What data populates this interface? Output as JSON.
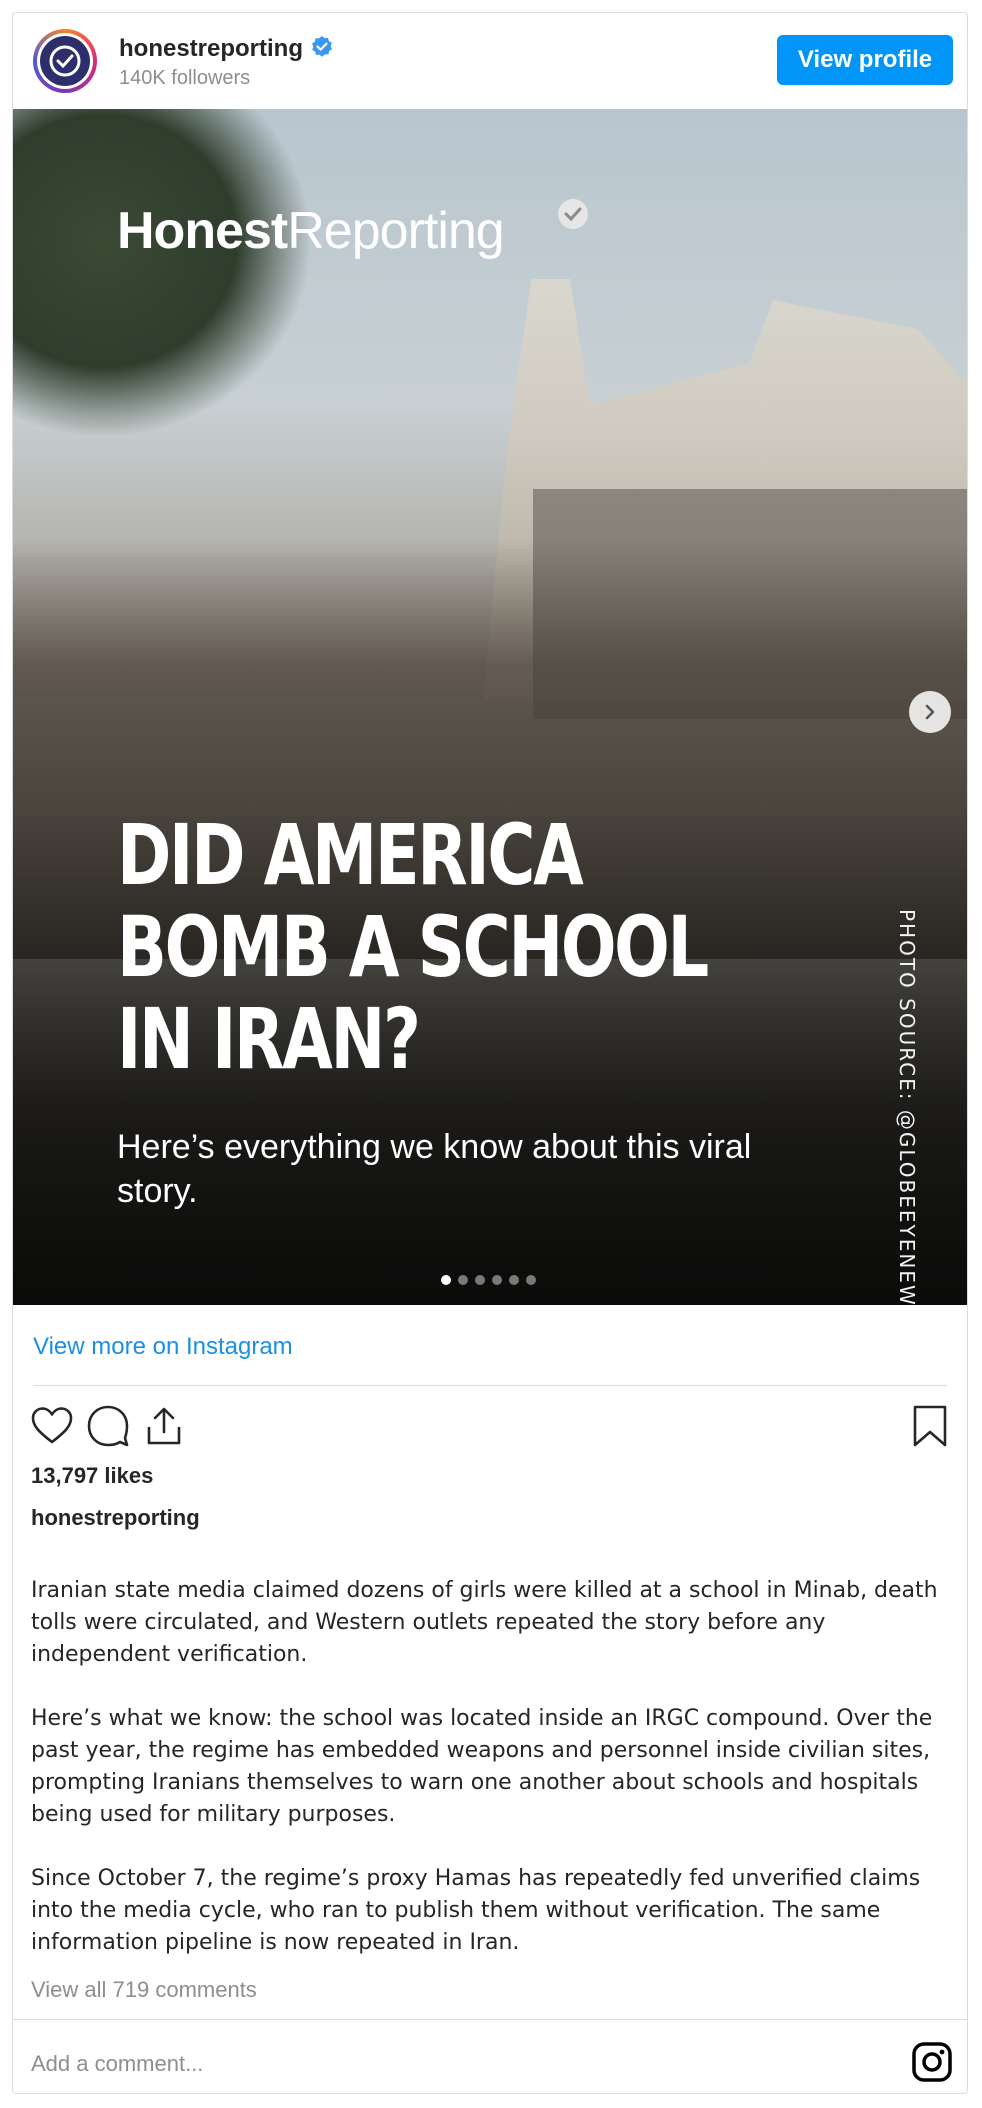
{
  "header": {
    "username": "honestreporting",
    "followers": "140K followers",
    "view_profile_label": "View profile"
  },
  "media": {
    "brand_bold": "Honest",
    "brand_light": "Reporting",
    "headline": "DID AMERICA\nBOMB A SCHOOL\nIN IRAN?",
    "subhead": "Here’s everything we know about this viral story.",
    "photo_source": "PHOTO SOURCE: @GLOBEEYENEWS/X",
    "slide_count": 6,
    "active_slide": 1
  },
  "view_more_label": "View more on Instagram",
  "likes": "13,797 likes",
  "caption": {
    "username": "honestreporting",
    "paragraphs": [
      "Iranian state media claimed dozens of girls were killed at a school in Minab, death tolls were circulated, and Western outlets repeated the story before any independent verification.",
      "Here’s what we know: the school was located inside an IRGC compound. Over the past year, the regime has embedded weapons and personnel inside civilian sites, prompting Iranians themselves to warn one another about schools and hospitals being used for military purposes.",
      "Since October 7, the regime’s proxy Hamas has repeatedly fed unverified claims into the media cycle, who ran to publish them without verification. The same information pipeline is now repeated in Iran."
    ]
  },
  "view_all_comments": "View all 719 comments",
  "add_comment_placeholder": "Add a comment...",
  "colors": {
    "accent": "#0095f6",
    "link": "#1b8fe0",
    "muted": "#8e8e8e",
    "verified": "#3897f0"
  },
  "icons": {
    "verified": "verified-badge-icon",
    "like": "heart-icon",
    "comment": "comment-bubble-icon",
    "share": "share-icon",
    "save": "bookmark-icon",
    "next": "chevron-right-icon",
    "instagram": "instagram-icon"
  }
}
